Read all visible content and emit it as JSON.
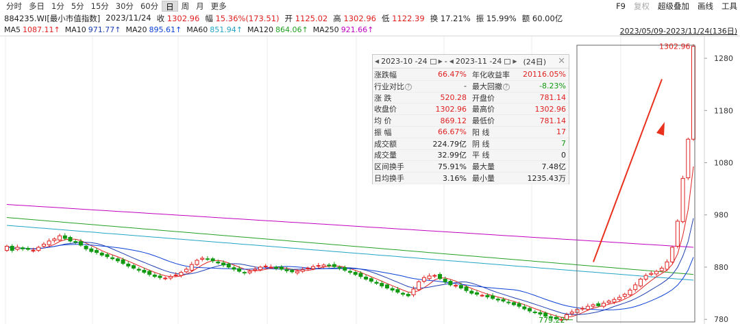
{
  "toolbar": {
    "tabs": [
      "分时",
      "多日",
      "1分",
      "5分",
      "15分",
      "30分",
      "60分",
      "日",
      "周",
      "月",
      "更多"
    ],
    "active_tab": "日",
    "right_items": [
      "F9",
      "复权",
      "超级叠加",
      "画线",
      "工具"
    ]
  },
  "quote": {
    "code_name": "884235.WI[最小市值指数]",
    "date": "2023/11/24",
    "close_label": "收",
    "close": "1302.96",
    "change_label": "幅",
    "change": "15.36%(173.51)",
    "open_label": "开",
    "open": "1125.02",
    "high_label": "高",
    "high": "1302.96",
    "low_label": "低",
    "low": "1122.39",
    "turnover_label": "换",
    "turnover": "17.21%",
    "amplitude_label": "振",
    "amplitude": "15.99%",
    "amount_label": "额",
    "amount": "60.00亿"
  },
  "ma": {
    "items": [
      {
        "label": "MA5",
        "value": "1087.11↑",
        "color": "#e02020"
      },
      {
        "label": "MA10",
        "value": "971.77↑",
        "color": "#1f3fb0"
      },
      {
        "label": "MA20",
        "value": "895.61↑",
        "color": "#0b3fd6"
      },
      {
        "label": "MA60",
        "value": "851.94↑",
        "color": "#22a3c4"
      },
      {
        "label": "MA120",
        "value": "864.06↑",
        "color": "#22a022"
      },
      {
        "label": "MA250",
        "value": "921.66↑",
        "color": "#c000c0"
      }
    ],
    "range": "2023/05/09-2023/11/24(136日)"
  },
  "popup": {
    "start": "2023-10 -24",
    "end": "2023-11 -24",
    "dash": "-",
    "days": "(24日)",
    "rows": [
      {
        "k1": "涨跌幅",
        "v1": "66.47%",
        "c1": "red",
        "k2": "年化收益率",
        "v2": "20116.05%",
        "c2": "red"
      },
      {
        "k1": "行业对比",
        "q1": true,
        "v1": "-",
        "c1": "black",
        "k2": "最大回撤",
        "q2": true,
        "v2": "-8.23%",
        "c2": "green"
      },
      {
        "k1": "涨  跌",
        "v1": "520.28",
        "c1": "red",
        "k2": "开盘价",
        "v2": "781.14",
        "c2": "red"
      },
      {
        "k1": "收盘价",
        "v1": "1302.96",
        "c1": "red",
        "k2": "最高价",
        "v2": "1302.96",
        "c2": "red"
      },
      {
        "k1": "均  价",
        "v1": "869.12",
        "c1": "red",
        "k2": "最低价",
        "v2": "781.14",
        "c2": "red"
      },
      {
        "k1": "振  幅",
        "v1": "66.67%",
        "c1": "red",
        "k2": "阳  线",
        "v2": "17",
        "c2": "red"
      },
      {
        "k1": "成交额",
        "v1": "224.79亿",
        "c1": "black",
        "k2": "阴  线",
        "v2": "7",
        "c2": "green"
      },
      {
        "k1": "成交量",
        "v1": "32.99亿",
        "c1": "black",
        "k2": "平  线",
        "v2": "0",
        "c2": "black"
      },
      {
        "k1": "区间换手",
        "v1": "75.91%",
        "c1": "black",
        "k2": "最大量",
        "v2": "7.48亿",
        "c2": "black"
      },
      {
        "k1": "日均换手",
        "v1": "3.16%",
        "c1": "black",
        "k2": "最小量",
        "v2": "1235.43万",
        "c2": "black"
      }
    ]
  },
  "chart_data": {
    "type": "candlestick",
    "yticks": [
      1280,
      1180,
      1080,
      980,
      880,
      780
    ],
    "ylim": [
      775,
      1305
    ],
    "annotations": {
      "high_label": "1302.96",
      "low_label": "779.22"
    },
    "colors": {
      "up": "#e02020",
      "down": "#119911",
      "arrow": "#e8301c"
    },
    "closes": [
      920,
      912,
      918,
      915,
      914,
      912,
      918,
      924,
      930,
      934,
      940,
      935,
      930,
      928,
      922,
      915,
      910,
      908,
      903,
      900,
      896,
      892,
      887,
      882,
      878,
      874,
      870,
      866,
      862,
      860,
      859,
      862,
      865,
      870,
      876,
      885,
      893,
      897,
      895,
      892,
      888,
      884,
      880,
      876,
      872,
      869,
      872,
      876,
      880,
      882,
      880,
      878,
      876,
      873,
      871,
      872,
      875,
      878,
      881,
      883,
      884,
      883,
      881,
      878,
      874,
      870,
      866,
      862,
      857,
      853,
      849,
      844,
      840,
      836,
      832,
      828,
      825,
      838,
      852,
      860,
      863,
      864,
      858,
      852,
      846,
      845,
      840,
      835,
      830,
      828,
      826,
      823,
      820,
      817,
      815,
      812,
      808,
      805,
      800,
      796,
      793,
      790,
      786,
      783,
      781,
      780,
      789,
      794,
      799,
      801,
      805,
      808,
      806,
      811,
      815,
      818,
      822,
      828,
      836,
      846,
      857,
      864,
      868,
      872,
      878,
      890,
      918,
      968,
      1050,
      1125,
      1302.96
    ],
    "ma_series": [
      {
        "name": "MA250",
        "color": "#c000c0",
        "values": [
          1000,
          918
        ]
      },
      {
        "name": "MA120",
        "color": "#22a022",
        "values": [
          975,
          866
        ]
      },
      {
        "name": "MA60",
        "color": "#22a3c4",
        "values": [
          960,
          855
        ]
      }
    ]
  }
}
